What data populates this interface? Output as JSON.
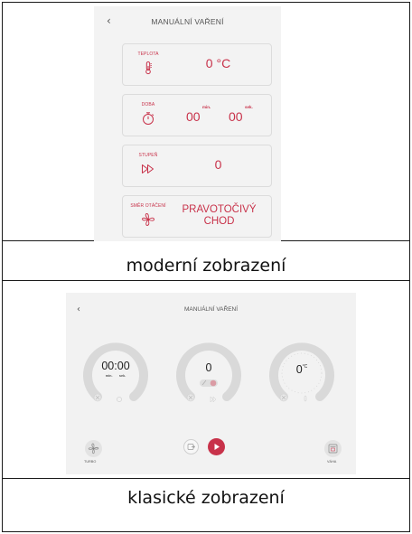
{
  "modern": {
    "back_icon": "chevron-left-icon",
    "title": "MANUÁLNÍ VAŘENÍ",
    "cards": {
      "temperature": {
        "label": "TEPLOTA",
        "value": "0 °C",
        "icon": "thermometer-icon"
      },
      "duration": {
        "label": "DOBA",
        "minutes": "00",
        "minutes_unit": "min.",
        "seconds": "00",
        "seconds_unit": "sek.",
        "icon": "timer-icon"
      },
      "speed": {
        "label": "STUPEŇ",
        "value": "0",
        "icon": "fast-forward-icon"
      },
      "rotation": {
        "label": "SMĚR OTÁČENÍ",
        "value_line1": "PRAVOTOČIVÝ",
        "value_line2": "CHOD",
        "icon": "fan-rotation-icon"
      }
    }
  },
  "modern_caption": "moderní zobrazení",
  "classic": {
    "back_icon": "chevron-left-icon",
    "title": "MANUÁLNÍ VAŘENÍ",
    "time_dial": {
      "value": "00:00",
      "min_unit": "min.",
      "sec_unit": "sek."
    },
    "speed_dial": {
      "value": "0"
    },
    "temp_dial": {
      "value": "0",
      "unit": "°C"
    },
    "turbo_label": "TURBO",
    "scale_label": "VÁHA"
  },
  "classic_caption": "klasické zobrazení",
  "colors": {
    "accent": "#c8324a",
    "panel": "#f3f3f3",
    "ring": "#d9d9d9"
  }
}
